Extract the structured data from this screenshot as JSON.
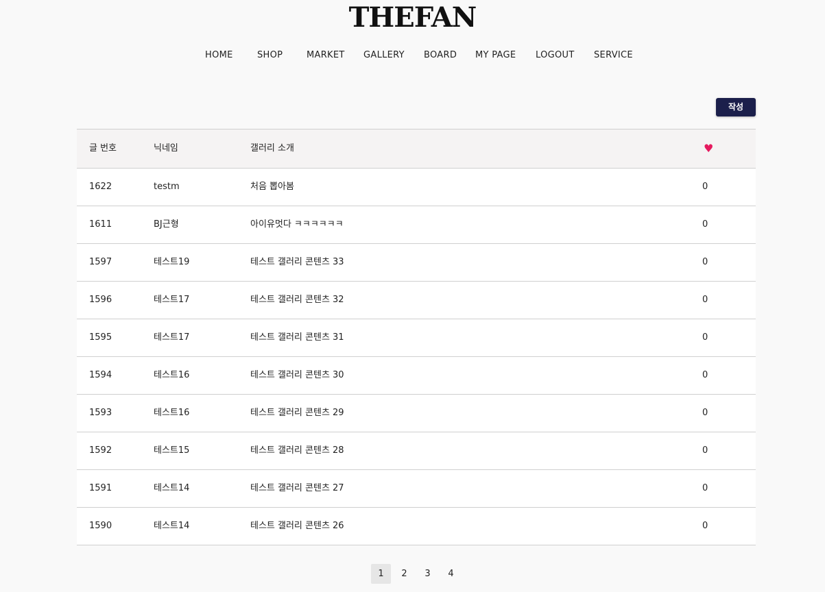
{
  "header": {
    "logo": "THEFAN",
    "nav": [
      "HOME",
      "SHOP",
      "MARKET",
      "GALLERY",
      "BOARD",
      "MY PAGE",
      "LOGOUT",
      "SERVICE"
    ]
  },
  "toolbar": {
    "write_label": "작성"
  },
  "table": {
    "columns": {
      "no": "글 번호",
      "nickname": "닉네임",
      "intro": "갤러리 소개",
      "like_icon": "heart-icon"
    },
    "rows": [
      {
        "no": "1622",
        "nickname": "testm",
        "intro": "처음 뽑아봄",
        "likes": "0"
      },
      {
        "no": "1611",
        "nickname": "BJ근형",
        "intro": "아이유멋다 ㅋㅋㅋㅋㅋㅋ",
        "likes": "0"
      },
      {
        "no": "1597",
        "nickname": "테스트19",
        "intro": "테스트 갤러리 콘텐츠 33",
        "likes": "0"
      },
      {
        "no": "1596",
        "nickname": "테스트17",
        "intro": "테스트 갤러리 콘텐츠 32",
        "likes": "0"
      },
      {
        "no": "1595",
        "nickname": "테스트17",
        "intro": "테스트 갤러리 콘텐츠 31",
        "likes": "0"
      },
      {
        "no": "1594",
        "nickname": "테스트16",
        "intro": "테스트 갤러리 콘텐츠 30",
        "likes": "0"
      },
      {
        "no": "1593",
        "nickname": "테스트16",
        "intro": "테스트 갤러리 콘텐츠 29",
        "likes": "0"
      },
      {
        "no": "1592",
        "nickname": "테스트15",
        "intro": "테스트 갤러리 콘텐츠 28",
        "likes": "0"
      },
      {
        "no": "1591",
        "nickname": "테스트14",
        "intro": "테스트 갤러리 콘텐츠 27",
        "likes": "0"
      },
      {
        "no": "1590",
        "nickname": "테스트14",
        "intro": "테스트 갤러리 콘텐츠 26",
        "likes": "0"
      }
    ]
  },
  "pagination": {
    "pages": [
      "1",
      "2",
      "3",
      "4"
    ],
    "current": "1"
  },
  "colors": {
    "accent": "#1b1f4b",
    "heart": "#e5195e"
  }
}
